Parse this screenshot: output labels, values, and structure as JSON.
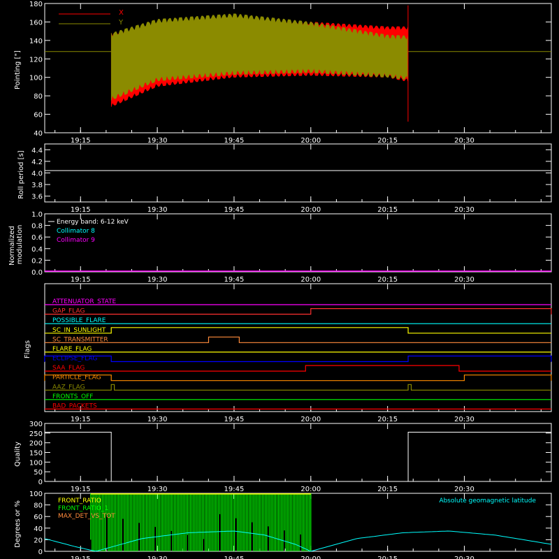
{
  "chart_data": [
    {
      "type": "line",
      "ylabel": "Pointing [\"]",
      "ylim": [
        40,
        180
      ],
      "yticks": [
        40,
        60,
        80,
        100,
        120,
        140,
        160,
        180
      ],
      "xticks": [
        "19:15",
        "19:30",
        "19:45",
        "20:00",
        "20:15",
        "20:30"
      ],
      "xlim": [
        "19:08",
        "20:47"
      ],
      "legend": [
        {
          "name": "X",
          "color": "#ff0000"
        },
        {
          "name": "Y",
          "color": "#8b8b00"
        }
      ],
      "baseline": 128,
      "active_range": [
        "19:21",
        "20:19"
      ],
      "series": [
        {
          "name": "X",
          "color": "#ff0000",
          "upper": [
            [
              19.35,
              148
            ],
            [
              19.5,
              160
            ],
            [
              19.75,
              166
            ],
            [
              20.0,
              160
            ],
            [
              20.25,
              155
            ],
            [
              20.32,
              155
            ]
          ],
          "lower": [
            [
              19.35,
              68
            ],
            [
              19.5,
              90
            ],
            [
              19.75,
              100
            ],
            [
              20.0,
              102
            ],
            [
              20.25,
              100
            ],
            [
              20.32,
              95
            ]
          ]
        },
        {
          "name": "Y",
          "color": "#8b8b00",
          "upper": [
            [
              19.35,
              148
            ],
            [
              19.5,
              163
            ],
            [
              19.75,
              169
            ],
            [
              20.0,
              160
            ],
            [
              20.25,
              146
            ],
            [
              20.32,
              145
            ]
          ],
          "lower": [
            [
              19.35,
              75
            ],
            [
              19.5,
              96
            ],
            [
              19.75,
              103
            ],
            [
              20.0,
              105
            ],
            [
              20.25,
              100
            ],
            [
              20.32,
              97
            ]
          ]
        }
      ]
    },
    {
      "type": "line",
      "ylabel": "Roll period [s]",
      "ylim": [
        3.5,
        4.5
      ],
      "yticks": [
        "3.6",
        "3.8",
        "4.0",
        "4.2",
        "4.4"
      ],
      "xticks": [
        "19:15",
        "19:30",
        "19:45",
        "20:00",
        "20:15",
        "20:30"
      ],
      "series": [
        {
          "name": "",
          "color": "#ffffff",
          "value": 4.04
        }
      ]
    },
    {
      "type": "line",
      "ylabel": "Normalized modulation",
      "ylim": [
        0,
        1
      ],
      "yticks": [
        "0.0",
        "0.2",
        "0.4",
        "0.6",
        "0.8",
        "1.0"
      ],
      "xticks": [
        "19:15",
        "19:30",
        "19:45",
        "20:00",
        "20:15",
        "20:30"
      ],
      "annotations": [
        {
          "text": "Energy band: 6-12 keV",
          "color": "#ffffff"
        },
        {
          "text": "Collimator 8",
          "color": "#00ffff"
        },
        {
          "text": "Collimator 9",
          "color": "#ff00ff"
        }
      ],
      "series": [
        {
          "name": "Collimator 9",
          "color": "#ff00ff",
          "value": 0
        }
      ]
    },
    {
      "type": "line",
      "ylabel": "Flags",
      "xticks": [
        "19:15",
        "19:30",
        "19:45",
        "20:00",
        "20:15",
        "20:30"
      ],
      "flags": [
        {
          "name": "ATTENUATOR_STATE",
          "color": "#ff00ff",
          "on": []
        },
        {
          "name": "GAP_FLAG",
          "color": "#ff3030",
          "on": [
            [
              20.0,
              20.783
            ]
          ]
        },
        {
          "name": "POSSIBLE_FLARE",
          "color": "#00ffff",
          "on": []
        },
        {
          "name": "SC_IN_SUNLIGHT",
          "color": "#ffff00",
          "on": [
            [
              19.35,
              20.317
            ]
          ]
        },
        {
          "name": "SC_TRANSMITTER",
          "color": "#ff8c3c",
          "on": [
            [
              19.667,
              19.767
            ]
          ]
        },
        {
          "name": "FLARE_FLAG",
          "color": "#ffff00",
          "on": []
        },
        {
          "name": "ECLIPSE_FLAG",
          "color": "#0000ff",
          "on": [
            [
              19.133,
              19.35
            ],
            [
              20.317,
              20.783
            ]
          ]
        },
        {
          "name": "SAA_FLAG",
          "color": "#ff0000",
          "on": [
            [
              19.983,
              20.483
            ]
          ]
        },
        {
          "name": "PARTICLE_FLAG",
          "color": "#ff8c00",
          "on": [
            [
              19.133,
              19.35
            ],
            [
              20.5,
              20.783
            ]
          ]
        },
        {
          "name": "AAZ_FLAG",
          "color": "#8b8b00",
          "on": [
            [
              19.35,
              19.36
            ],
            [
              20.317,
              20.327
            ]
          ]
        },
        {
          "name": "FRONTS_OFF",
          "color": "#00ff00",
          "on": []
        },
        {
          "name": "BAD_PACKETS",
          "color": "#ff0000",
          "on": []
        }
      ]
    },
    {
      "type": "line",
      "ylabel": "Quality",
      "ylim": [
        0,
        300
      ],
      "yticks": [
        "0",
        "50",
        "100",
        "150",
        "200",
        "250",
        "300"
      ],
      "xticks": [
        "19:15",
        "19:30",
        "19:45",
        "20:00",
        "20:15",
        "20:30"
      ],
      "series": [
        {
          "name": "",
          "color": "#ffffff",
          "segments": [
            [
              [
                19.133,
                255
              ],
              [
                19.35,
                255
              ]
            ],
            [
              [
                19.35,
                0
              ],
              [
                20.317,
                0
              ]
            ],
            [
              [
                20.317,
                255
              ],
              [
                20.783,
                255
              ]
            ]
          ]
        }
      ]
    },
    {
      "type": "line",
      "ylabel": "Degrees or %",
      "ylim": [
        0,
        100
      ],
      "yticks": [
        "0",
        "20",
        "40",
        "60",
        "80",
        "100"
      ],
      "xticks": [
        "19:15",
        "19:30",
        "19:45",
        "20:00",
        "20:15",
        "20:30"
      ],
      "legend": [
        {
          "name": "FRONT_RATIO",
          "color": "#ffff00"
        },
        {
          "name": "FRONT_RATIO_1",
          "color": "#00ff00"
        },
        {
          "name": "MAX_DET_VS_TOT",
          "color": "#ff8c3c"
        }
      ],
      "annotation": {
        "text": "Absolute geomagnetic latitude",
        "color": "#00ffff"
      },
      "series": [
        {
          "name": "Absolute geomagnetic latitude",
          "color": "#00ffff",
          "points": [
            [
              19.133,
              22
            ],
            [
              19.233,
              8
            ],
            [
              19.3,
              0
            ],
            [
              19.45,
              22
            ],
            [
              19.6,
              32
            ],
            [
              19.75,
              35
            ],
            [
              19.85,
              28
            ],
            [
              19.95,
              12
            ],
            [
              20.0,
              0
            ],
            [
              20.15,
              22
            ],
            [
              20.3,
              32
            ],
            [
              20.45,
              35
            ],
            [
              20.6,
              28
            ],
            [
              20.75,
              15
            ],
            [
              20.783,
              12
            ]
          ]
        },
        {
          "name": "FRONT_RATIO_1",
          "color": "#00ff00",
          "range": [
            19.283,
            20.0
          ],
          "level": 100
        }
      ]
    }
  ]
}
